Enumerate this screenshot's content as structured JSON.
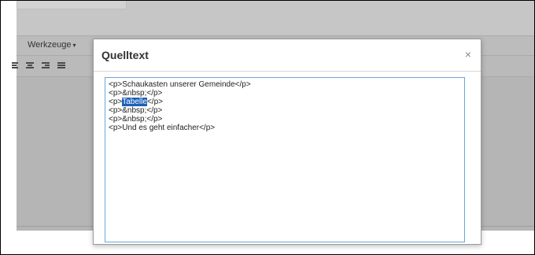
{
  "editor": {
    "menu": {
      "tools_label": "Werkzeuge",
      "caret": "▾"
    }
  },
  "dialog": {
    "title": "Quelltext",
    "close_glyph": "×",
    "source_lines": {
      "l1": "<p>Schaukasten unserer Gemeinde</p>",
      "l2": "<p>&nbsp;</p>",
      "l3_before": "<p>",
      "l3_selected": "Tabelle",
      "l3_after": "</p>",
      "l4": "<p>&nbsp;</p>",
      "l5": "<p>&nbsp;</p>",
      "l6": "<p>Und es geht einfacher</p>"
    }
  },
  "colors": {
    "selection": "#1c5fb8",
    "textarea_border": "#6aa6d8",
    "backdrop": "#b8b8b8"
  },
  "icons": [
    "align-left-icon",
    "align-center-icon",
    "align-right-icon",
    "align-justify-icon",
    "close-icon"
  ]
}
